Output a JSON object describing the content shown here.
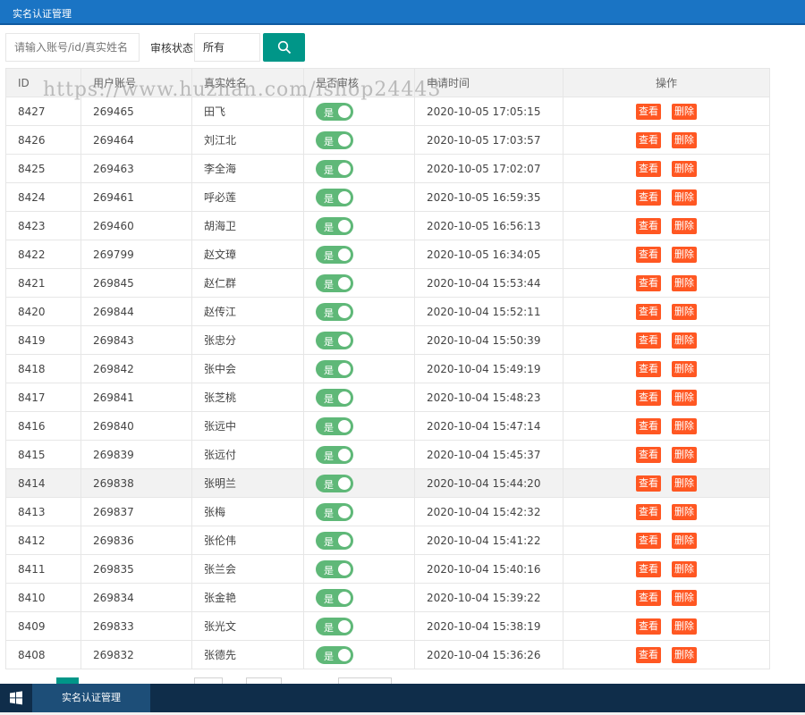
{
  "window": {
    "title": "实名认证管理"
  },
  "search": {
    "placeholder": "请输入账号/id/真实姓名",
    "status_label": "审核状态",
    "status_value": "所有"
  },
  "table": {
    "headers": [
      "ID",
      "用户账号",
      "真实姓名",
      "是否审核",
      "申请时间",
      "操作"
    ],
    "toggle_label": "是",
    "view_label": "查看",
    "delete_label": "删除",
    "rows": [
      [
        "8427",
        "269465",
        "田飞",
        "2020-10-05 17:05:15"
      ],
      [
        "8426",
        "269464",
        "刘江北",
        "2020-10-05 17:03:57"
      ],
      [
        "8425",
        "269463",
        "李全海",
        "2020-10-05 17:02:07"
      ],
      [
        "8424",
        "269461",
        "呼必莲",
        "2020-10-05 16:59:35"
      ],
      [
        "8423",
        "269460",
        "胡海卫",
        "2020-10-05 16:56:13"
      ],
      [
        "8422",
        "269799",
        "赵文璋",
        "2020-10-05 16:34:05"
      ],
      [
        "8421",
        "269845",
        "赵仁群",
        "2020-10-04 15:53:44"
      ],
      [
        "8420",
        "269844",
        "赵传江",
        "2020-10-04 15:52:11"
      ],
      [
        "8419",
        "269843",
        "张忠分",
        "2020-10-04 15:50:39"
      ],
      [
        "8418",
        "269842",
        "张中会",
        "2020-10-04 15:49:19"
      ],
      [
        "8417",
        "269841",
        "张芝桃",
        "2020-10-04 15:48:23"
      ],
      [
        "8416",
        "269840",
        "张远中",
        "2020-10-04 15:47:14"
      ],
      [
        "8415",
        "269839",
        "张远付",
        "2020-10-04 15:45:37"
      ],
      [
        "8414",
        "269838",
        "张明兰",
        "2020-10-04 15:44:20"
      ],
      [
        "8413",
        "269837",
        "张梅",
        "2020-10-04 15:42:32"
      ],
      [
        "8412",
        "269836",
        "张伦伟",
        "2020-10-04 15:41:22"
      ],
      [
        "8411",
        "269835",
        "张兰会",
        "2020-10-04 15:40:16"
      ],
      [
        "8410",
        "269834",
        "张金艳",
        "2020-10-04 15:39:22"
      ],
      [
        "8409",
        "269833",
        "张光文",
        "2020-10-04 15:38:19"
      ],
      [
        "8408",
        "269832",
        "张德先",
        "2020-10-04 15:36:26"
      ]
    ],
    "highlighted_row": 13
  },
  "watermark": "https://www.huzhan.com/ishop24443",
  "taskbar": {
    "item_label": "实名认证管理"
  },
  "colors": {
    "titlebar": "#1a74c4",
    "primary": "#009688",
    "switch_on": "#5fb878",
    "danger": "#ff5722",
    "taskbar": "#0f2d4a"
  },
  "icons": {
    "search": "search-icon",
    "start": "windows-logo-icon"
  }
}
